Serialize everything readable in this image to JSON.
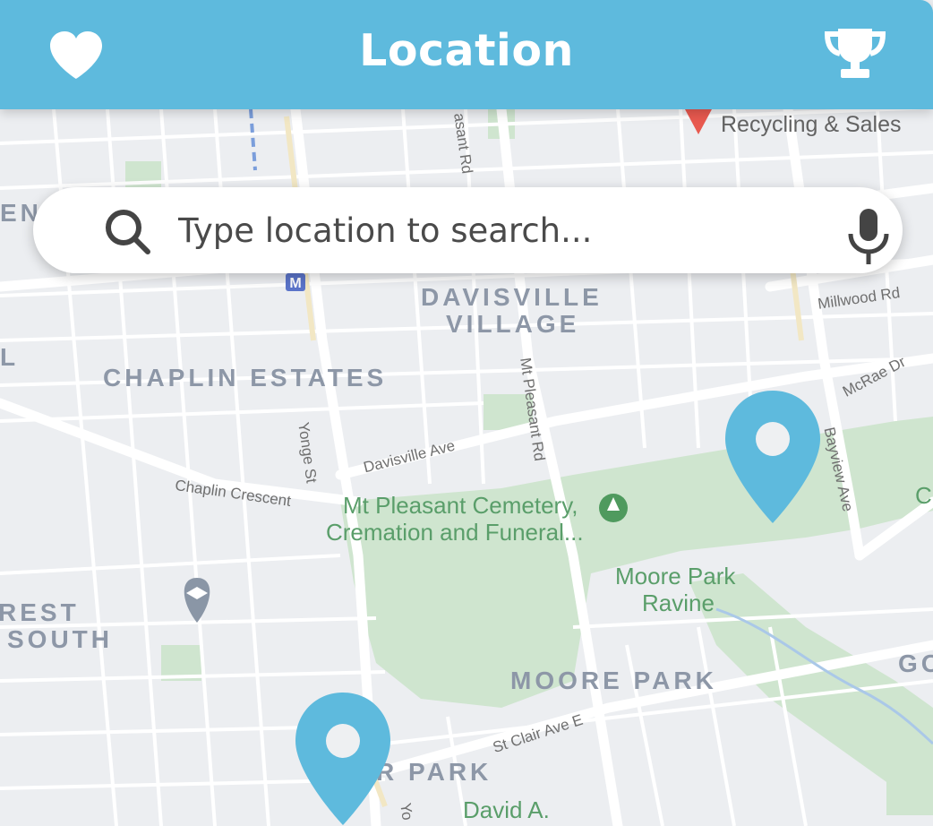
{
  "header": {
    "title": "Location",
    "left_icon": "heart-icon",
    "right_icon": "trophy-icon",
    "background": "#5ebadd"
  },
  "search": {
    "placeholder": "Type location to search...",
    "search_icon": "search-icon",
    "mic_icon": "microphone-icon"
  },
  "map": {
    "neighborhoods": [
      "DAVISVILLE",
      "VILLAGE",
      "CHAPLIN ESTATES",
      "MOORE PARK",
      "REST",
      "SOUTH",
      "EN",
      "GO",
      "L",
      "C",
      "R PARK"
    ],
    "streets": [
      "Yonge St",
      "Davisville Ave",
      "Chaplin Crescent",
      "Mt Pleasant Rd",
      "Bayview Ave",
      "Millwood Rd",
      "McRae Dr",
      "St Clair Ave E",
      "asant Rd",
      "Yo"
    ],
    "places": {
      "recycling": "Recycling & Sales",
      "cemetery_line1": "Mt Pleasant Cemetery,",
      "cemetery_line2": "Cremation and Funeral...",
      "ravine_line1": "Moore Park",
      "ravine_line2": "Ravine",
      "david": "David A."
    },
    "metro_badge": "M",
    "pin_color": "#5ebadd",
    "park_color": "#cfe5cf",
    "road_color": "#ffffff"
  }
}
